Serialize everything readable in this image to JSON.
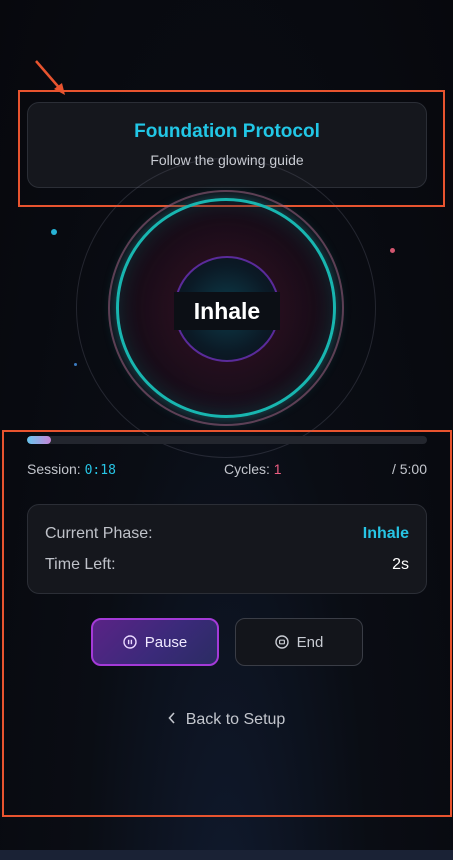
{
  "header": {
    "title": "Foundation Protocol",
    "subtitle": "Follow the glowing guide"
  },
  "breath": {
    "phase_label": "Inhale"
  },
  "progress": {
    "fraction": 0.06
  },
  "stats": {
    "session_label": "Session:",
    "session_value": "0:18",
    "cycles_label": "Cycles:",
    "cycles_value": "1",
    "total_duration": "/ 5:00"
  },
  "phase_card": {
    "current_phase_label": "Current Phase:",
    "current_phase_value": "Inhale",
    "time_left_label": "Time Left:",
    "time_left_value": "2s"
  },
  "controls": {
    "pause_label": "Pause",
    "end_label": "End"
  },
  "navigation": {
    "back_label": "Back to Setup"
  },
  "colors": {
    "accent_cyan": "#22c7e6",
    "accent_purple": "#a43ad8",
    "cycle_pink": "#ec5d82",
    "annotation_orange": "#e8542f"
  },
  "icons": {
    "pause": "pause-circle-icon",
    "end": "stop-circle-icon",
    "back": "chevron-left-icon"
  }
}
